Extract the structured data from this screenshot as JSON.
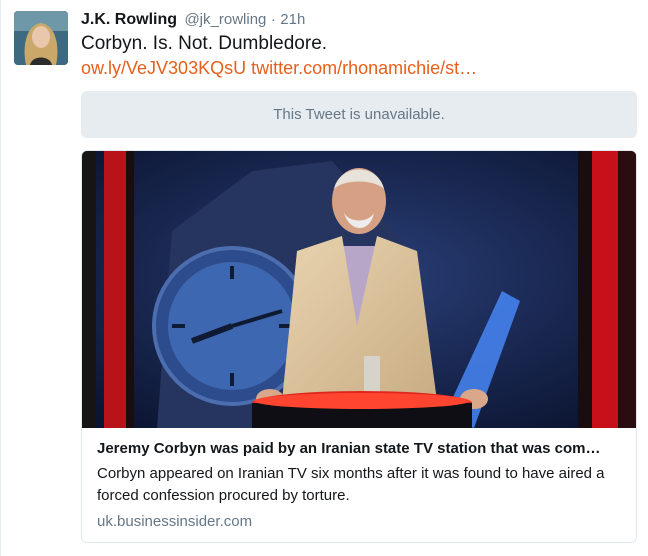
{
  "tweet": {
    "author_name": "J.K. Rowling",
    "author_handle": "@jk_rowling",
    "separator": "·",
    "time": "21h",
    "text": "Corbyn. Is. Not. Dumbledore.",
    "link_1": "ow.ly/VeJV303KQsU",
    "link_2": "twitter.com/rhonamichie/st…",
    "link_color": "#e65f1b"
  },
  "quoted_tweet": {
    "message": "This Tweet is unavailable."
  },
  "card": {
    "title": "Jeremy Corbyn was paid by an Iranian state TV station that was com…",
    "description": "Corbyn appeared on Iranian TV six months after it was found to have aired a forced confession procured by torture.",
    "domain": "uk.businessinsider.com"
  }
}
